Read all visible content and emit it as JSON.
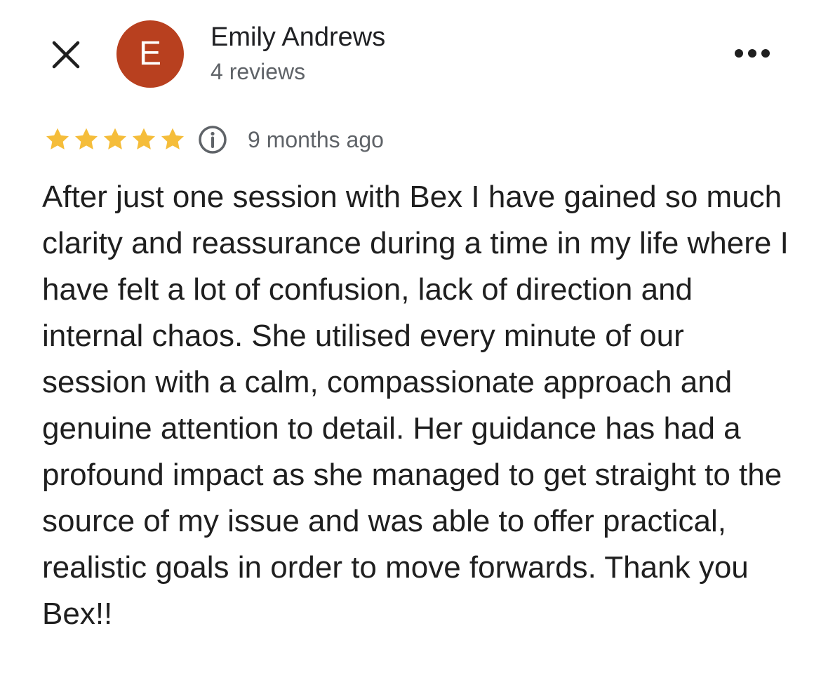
{
  "header": {
    "close_icon": "close-icon",
    "avatar_letter": "E",
    "avatar_color": "#b8401f",
    "reviewer_name": "Emily Andrews",
    "review_count": "4 reviews",
    "more_icon": "more-horizontal-icon"
  },
  "rating": {
    "stars": 5,
    "max_stars": 5,
    "star_color": "#f5bd3a",
    "info_icon": "info-icon",
    "time_ago": "9 months ago"
  },
  "review": {
    "text": "After just one session with Bex I have gained so much clarity and reassurance during a time in my life where I have felt a lot of confusion, lack of direction and internal chaos. She utilised every minute of our session with a calm, compassionate approach and genuine attention to detail. Her guidance has had a profound impact as she managed to get straight to the source of my issue and was able to offer practical, realistic goals in order to move forwards. Thank you Bex!!"
  }
}
